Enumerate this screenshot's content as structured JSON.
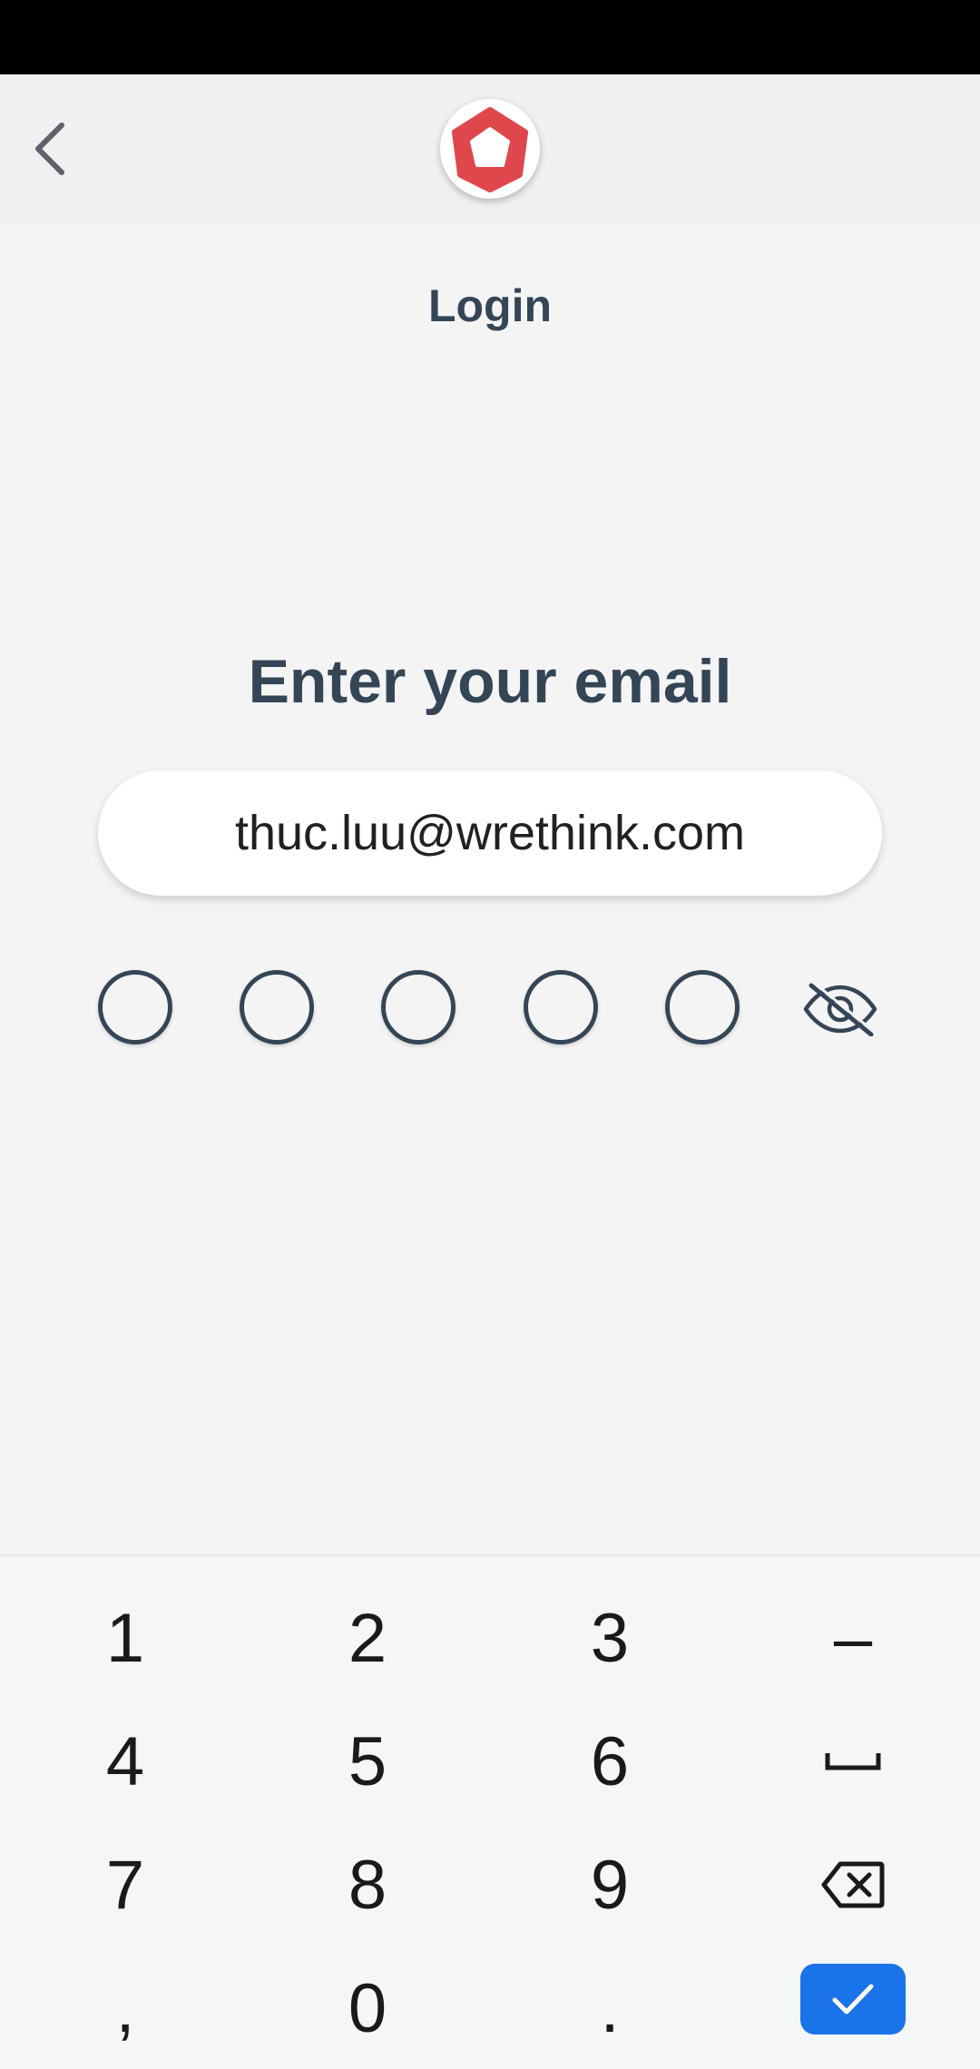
{
  "header": {
    "back_icon": "chevron-left-icon",
    "logo_icon": "pentagon-logo-icon",
    "logo_color": "#e0474c"
  },
  "page": {
    "title": "Login",
    "prompt": "Enter your email"
  },
  "email_field": {
    "value": "thuc.luu@wrethink.com"
  },
  "pin": {
    "length": 5,
    "filled": 0,
    "visibility_icon": "eye-off-icon"
  },
  "keyboard": {
    "keys": {
      "k1": "1",
      "k2": "2",
      "k3": "3",
      "dash": "–",
      "k4": "4",
      "k5": "5",
      "k6": "6",
      "k7": "7",
      "k8": "8",
      "k9": "9",
      "comma": ",",
      "k0": "0",
      "period": "."
    },
    "space_icon": "space-bar-icon",
    "backspace_icon": "backspace-icon",
    "confirm_icon": "checkmark-icon",
    "confirm_color": "#1a73e8"
  },
  "colors": {
    "text_primary": "#344556",
    "background": "#f4f4f5"
  }
}
